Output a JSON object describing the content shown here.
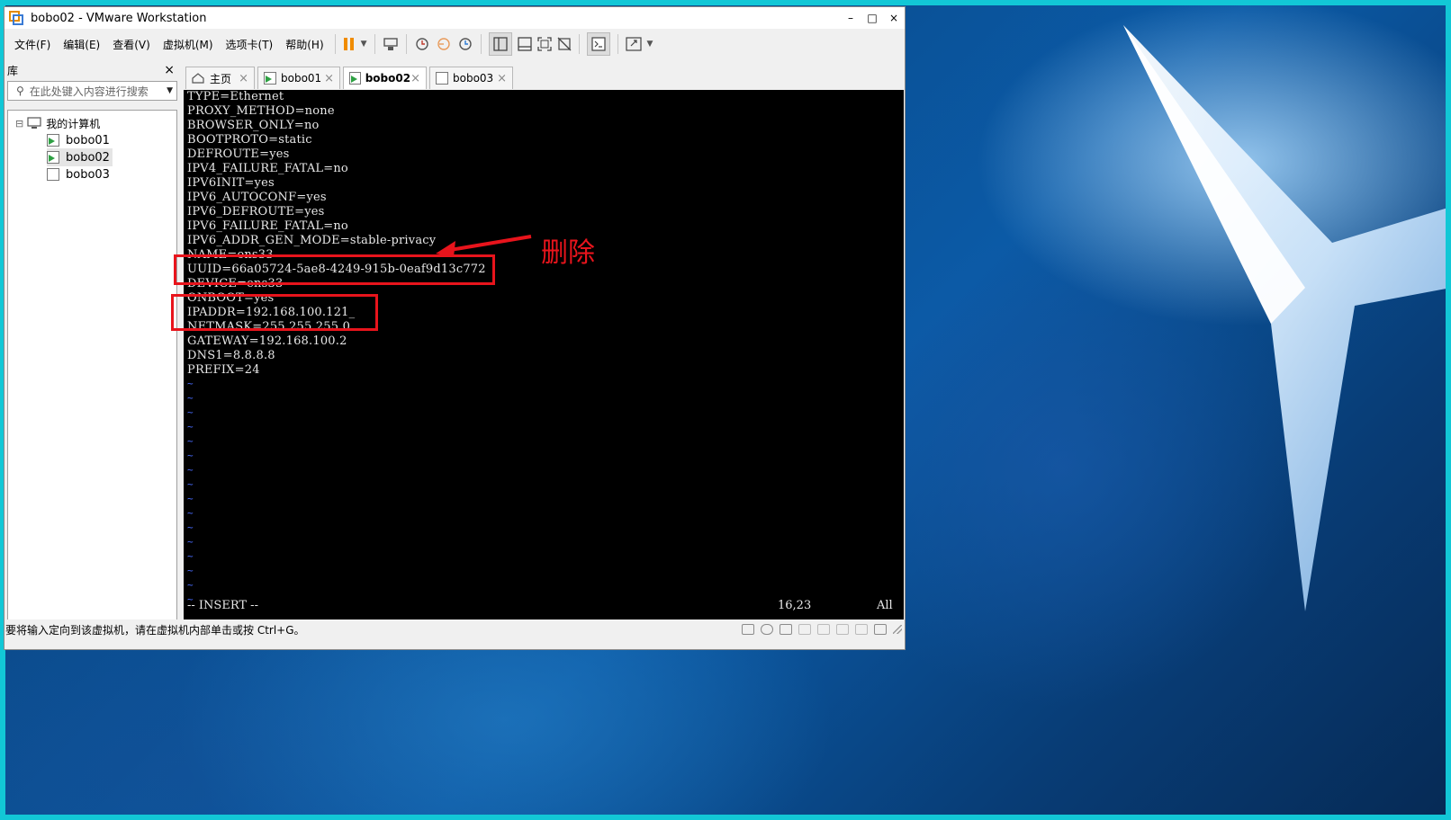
{
  "window": {
    "title": "bobo02 - VMware Workstation",
    "controls": {
      "minimize": "–",
      "maximize": "□",
      "close": "×"
    }
  },
  "menu": {
    "items": [
      "文件(F)",
      "编辑(E)",
      "查看(V)",
      "虚拟机(M)",
      "选项卡(T)",
      "帮助(H)"
    ]
  },
  "library": {
    "title": "库",
    "close": "×",
    "search_placeholder": "在此处键入内容进行搜索",
    "root": "我的计算机",
    "expander": "⊟",
    "vms": [
      "bobo01",
      "bobo02",
      "bobo03"
    ]
  },
  "tabs": [
    {
      "label": "主页",
      "close": "×"
    },
    {
      "label": "bobo01",
      "close": "×"
    },
    {
      "label": "bobo02",
      "close": "×"
    },
    {
      "label": "bobo03",
      "close": "×"
    }
  ],
  "console": {
    "lines": [
      "TYPE=Ethernet",
      "PROXY_METHOD=none",
      "BROWSER_ONLY=no",
      "BOOTPROTO=static",
      "DEFROUTE=yes",
      "IPV4_FAILURE_FATAL=no",
      "IPV6INIT=yes",
      "IPV6_AUTOCONF=yes",
      "IPV6_DEFROUTE=yes",
      "IPV6_FAILURE_FATAL=no",
      "IPV6_ADDR_GEN_MODE=stable-privacy",
      "NAME=ens33",
      "UUID=66a05724-5ae8-4249-915b-0eaf9d13c772",
      "DEVICE=ens33",
      "ONBOOT=yes",
      "IPADDR=192.168.100.121_",
      "NETMASK=255.255.255.0",
      "GATEWAY=192.168.100.2",
      "DNS1=8.8.8.8",
      "PREFIX=24"
    ],
    "tilde": "~",
    "tilde_count": 16,
    "mode": "-- INSERT --",
    "position": "16,23",
    "scroll": "All"
  },
  "annotation": {
    "label": "删除",
    "color": "#e8141c"
  },
  "statusbar": {
    "message": "要将输入定向到该虚拟机，请在虚拟机内部单击或按 Ctrl+G。"
  }
}
